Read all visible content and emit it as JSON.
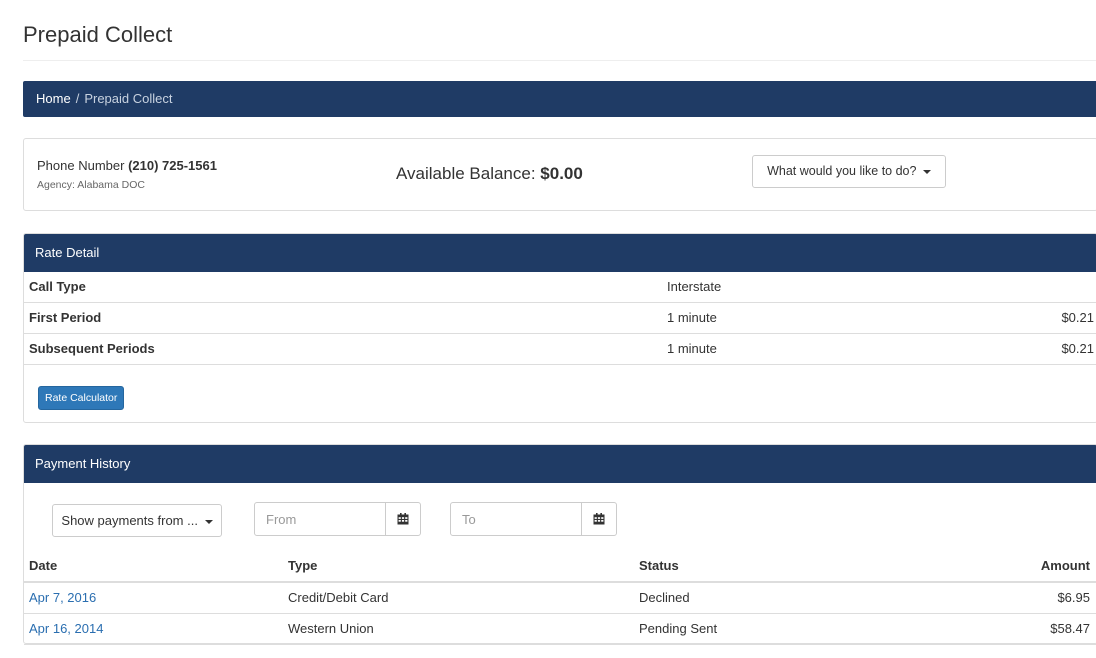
{
  "page": {
    "title": "Prepaid Collect"
  },
  "breadcrumb": {
    "home": "Home",
    "separator": "/",
    "current": "Prepaid Collect"
  },
  "account": {
    "phone_label": "Phone Number",
    "phone_number": "(210) 725-1561",
    "agency": "Agency: Alabama DOC",
    "balance_label": "Available Balance:",
    "balance_value": "$0.00",
    "action_dropdown": "What would you like to do?"
  },
  "rate_detail": {
    "heading": "Rate Detail",
    "rows": [
      {
        "label": "Call Type",
        "period": "Interstate",
        "rate": ""
      },
      {
        "label": "First Period",
        "period": "1 minute",
        "rate": "$0.21"
      },
      {
        "label": "Subsequent Periods",
        "period": "1 minute",
        "rate": "$0.21"
      }
    ],
    "calculator_button": "Rate Calculator"
  },
  "payment_history": {
    "heading": "Payment History",
    "filter_dropdown": "Show payments from ...",
    "from_placeholder": "From",
    "to_placeholder": "To",
    "columns": {
      "date": "Date",
      "type": "Type",
      "status": "Status",
      "amount": "Amount"
    },
    "rows": [
      {
        "date": "Apr 7, 2016",
        "type": "Credit/Debit Card",
        "status": "Declined",
        "amount": "$6.95"
      },
      {
        "date": "Apr 16, 2014",
        "type": "Western Union",
        "status": "Pending Sent",
        "amount": "$58.47"
      }
    ]
  },
  "icons": {
    "calendar": "calendar-icon",
    "caret": "caret-down-icon"
  },
  "colors": {
    "header_bar": "#1f3b65",
    "link": "#2a6eb0",
    "button": "#2e78b8"
  }
}
